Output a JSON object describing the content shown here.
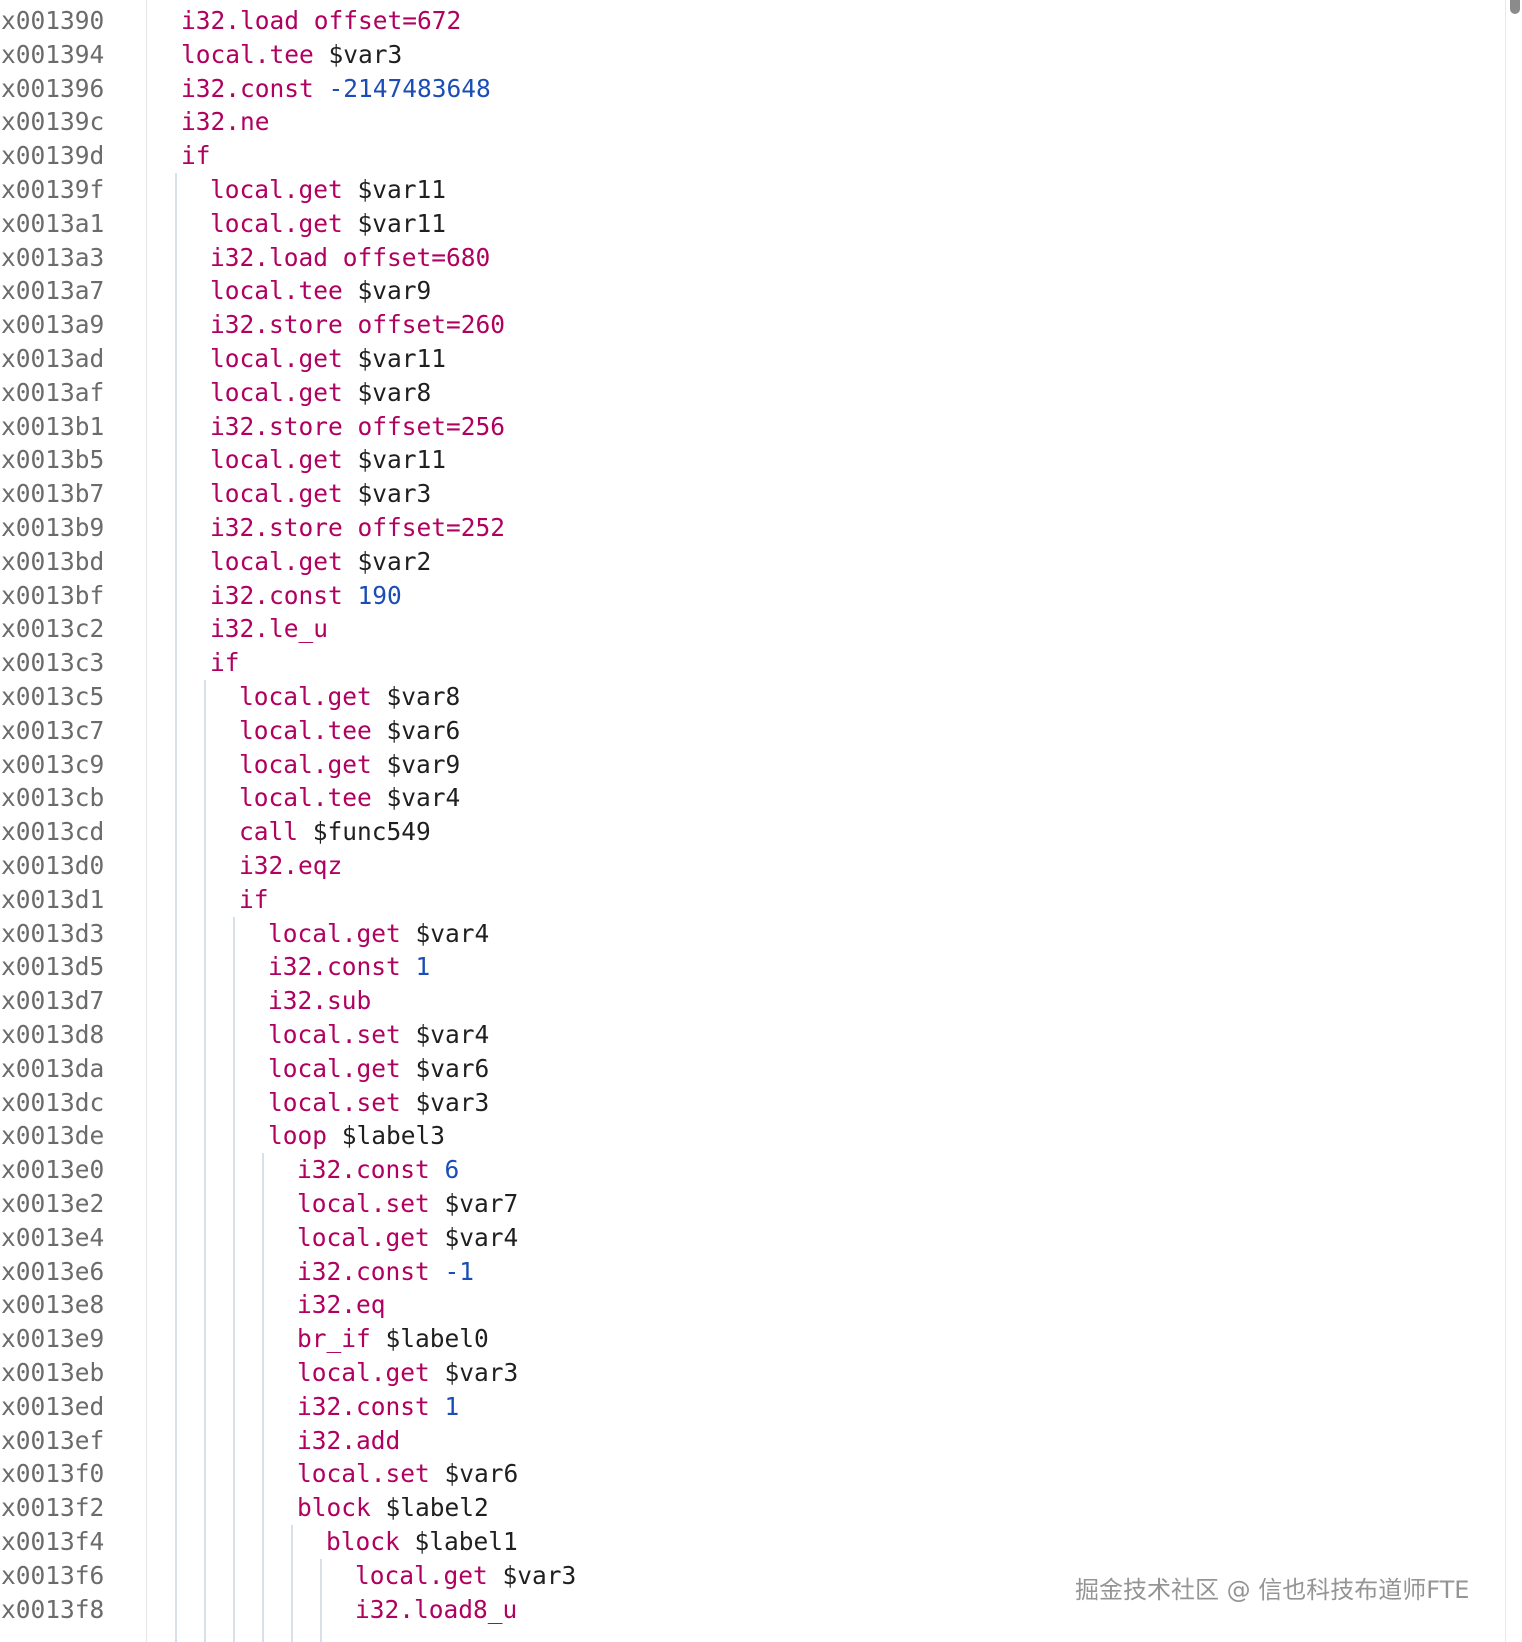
{
  "colors": {
    "keyword": "#b00060",
    "identifier": "#1f1f1f",
    "number": "#1a4db5",
    "address": "#6b6b6b",
    "guide": "#d8e0ea"
  },
  "watermark": "掘金技术社区 @ 信也科技布道师FTE",
  "lines": [
    {
      "addr": "x001390",
      "depth": 0,
      "op": "i32.load offset=672",
      "arg": "",
      "arg_type": ""
    },
    {
      "addr": "x001394",
      "depth": 0,
      "op": "local.tee",
      "arg": "$var3",
      "arg_type": "ident"
    },
    {
      "addr": "x001396",
      "depth": 0,
      "op": "i32.const",
      "arg": "-2147483648",
      "arg_type": "num"
    },
    {
      "addr": "x00139c",
      "depth": 0,
      "op": "i32.ne",
      "arg": "",
      "arg_type": ""
    },
    {
      "addr": "x00139d",
      "depth": 0,
      "op": "if",
      "arg": "",
      "arg_type": ""
    },
    {
      "addr": "x00139f",
      "depth": 1,
      "op": "local.get",
      "arg": "$var11",
      "arg_type": "ident"
    },
    {
      "addr": "x0013a1",
      "depth": 1,
      "op": "local.get",
      "arg": "$var11",
      "arg_type": "ident"
    },
    {
      "addr": "x0013a3",
      "depth": 1,
      "op": "i32.load offset=680",
      "arg": "",
      "arg_type": ""
    },
    {
      "addr": "x0013a7",
      "depth": 1,
      "op": "local.tee",
      "arg": "$var9",
      "arg_type": "ident"
    },
    {
      "addr": "x0013a9",
      "depth": 1,
      "op": "i32.store offset=260",
      "arg": "",
      "arg_type": ""
    },
    {
      "addr": "x0013ad",
      "depth": 1,
      "op": "local.get",
      "arg": "$var11",
      "arg_type": "ident"
    },
    {
      "addr": "x0013af",
      "depth": 1,
      "op": "local.get",
      "arg": "$var8",
      "arg_type": "ident"
    },
    {
      "addr": "x0013b1",
      "depth": 1,
      "op": "i32.store offset=256",
      "arg": "",
      "arg_type": ""
    },
    {
      "addr": "x0013b5",
      "depth": 1,
      "op": "local.get",
      "arg": "$var11",
      "arg_type": "ident"
    },
    {
      "addr": "x0013b7",
      "depth": 1,
      "op": "local.get",
      "arg": "$var3",
      "arg_type": "ident"
    },
    {
      "addr": "x0013b9",
      "depth": 1,
      "op": "i32.store offset=252",
      "arg": "",
      "arg_type": ""
    },
    {
      "addr": "x0013bd",
      "depth": 1,
      "op": "local.get",
      "arg": "$var2",
      "arg_type": "ident"
    },
    {
      "addr": "x0013bf",
      "depth": 1,
      "op": "i32.const",
      "arg": "190",
      "arg_type": "num"
    },
    {
      "addr": "x0013c2",
      "depth": 1,
      "op": "i32.le_u",
      "arg": "",
      "arg_type": ""
    },
    {
      "addr": "x0013c3",
      "depth": 1,
      "op": "if",
      "arg": "",
      "arg_type": ""
    },
    {
      "addr": "x0013c5",
      "depth": 2,
      "op": "local.get",
      "arg": "$var8",
      "arg_type": "ident"
    },
    {
      "addr": "x0013c7",
      "depth": 2,
      "op": "local.tee",
      "arg": "$var6",
      "arg_type": "ident"
    },
    {
      "addr": "x0013c9",
      "depth": 2,
      "op": "local.get",
      "arg": "$var9",
      "arg_type": "ident"
    },
    {
      "addr": "x0013cb",
      "depth": 2,
      "op": "local.tee",
      "arg": "$var4",
      "arg_type": "ident"
    },
    {
      "addr": "x0013cd",
      "depth": 2,
      "op": "call",
      "arg": "$func549",
      "arg_type": "ident"
    },
    {
      "addr": "x0013d0",
      "depth": 2,
      "op": "i32.eqz",
      "arg": "",
      "arg_type": ""
    },
    {
      "addr": "x0013d1",
      "depth": 2,
      "op": "if",
      "arg": "",
      "arg_type": ""
    },
    {
      "addr": "x0013d3",
      "depth": 3,
      "op": "local.get",
      "arg": "$var4",
      "arg_type": "ident"
    },
    {
      "addr": "x0013d5",
      "depth": 3,
      "op": "i32.const",
      "arg": "1",
      "arg_type": "num"
    },
    {
      "addr": "x0013d7",
      "depth": 3,
      "op": "i32.sub",
      "arg": "",
      "arg_type": ""
    },
    {
      "addr": "x0013d8",
      "depth": 3,
      "op": "local.set",
      "arg": "$var4",
      "arg_type": "ident"
    },
    {
      "addr": "x0013da",
      "depth": 3,
      "op": "local.get",
      "arg": "$var6",
      "arg_type": "ident"
    },
    {
      "addr": "x0013dc",
      "depth": 3,
      "op": "local.set",
      "arg": "$var3",
      "arg_type": "ident"
    },
    {
      "addr": "x0013de",
      "depth": 3,
      "op": "loop",
      "arg": "$label3",
      "arg_type": "ident"
    },
    {
      "addr": "x0013e0",
      "depth": 4,
      "op": "i32.const",
      "arg": "6",
      "arg_type": "num"
    },
    {
      "addr": "x0013e2",
      "depth": 4,
      "op": "local.set",
      "arg": "$var7",
      "arg_type": "ident"
    },
    {
      "addr": "x0013e4",
      "depth": 4,
      "op": "local.get",
      "arg": "$var4",
      "arg_type": "ident"
    },
    {
      "addr": "x0013e6",
      "depth": 4,
      "op": "i32.const",
      "arg": "-1",
      "arg_type": "num"
    },
    {
      "addr": "x0013e8",
      "depth": 4,
      "op": "i32.eq",
      "arg": "",
      "arg_type": ""
    },
    {
      "addr": "x0013e9",
      "depth": 4,
      "op": "br_if",
      "arg": "$label0",
      "arg_type": "ident"
    },
    {
      "addr": "x0013eb",
      "depth": 4,
      "op": "local.get",
      "arg": "$var3",
      "arg_type": "ident"
    },
    {
      "addr": "x0013ed",
      "depth": 4,
      "op": "i32.const",
      "arg": "1",
      "arg_type": "num"
    },
    {
      "addr": "x0013ef",
      "depth": 4,
      "op": "i32.add",
      "arg": "",
      "arg_type": ""
    },
    {
      "addr": "x0013f0",
      "depth": 4,
      "op": "local.set",
      "arg": "$var6",
      "arg_type": "ident"
    },
    {
      "addr": "x0013f2",
      "depth": 4,
      "op": "block",
      "arg": "$label2",
      "arg_type": "ident"
    },
    {
      "addr": "x0013f4",
      "depth": 5,
      "op": "block",
      "arg": "$label1",
      "arg_type": "ident"
    },
    {
      "addr": "x0013f6",
      "depth": 6,
      "op": "local.get",
      "arg": "$var3",
      "arg_type": "ident"
    },
    {
      "addr": "x0013f8",
      "depth": 6,
      "op": "i32.load8_u",
      "arg": "",
      "arg_type": ""
    }
  ]
}
